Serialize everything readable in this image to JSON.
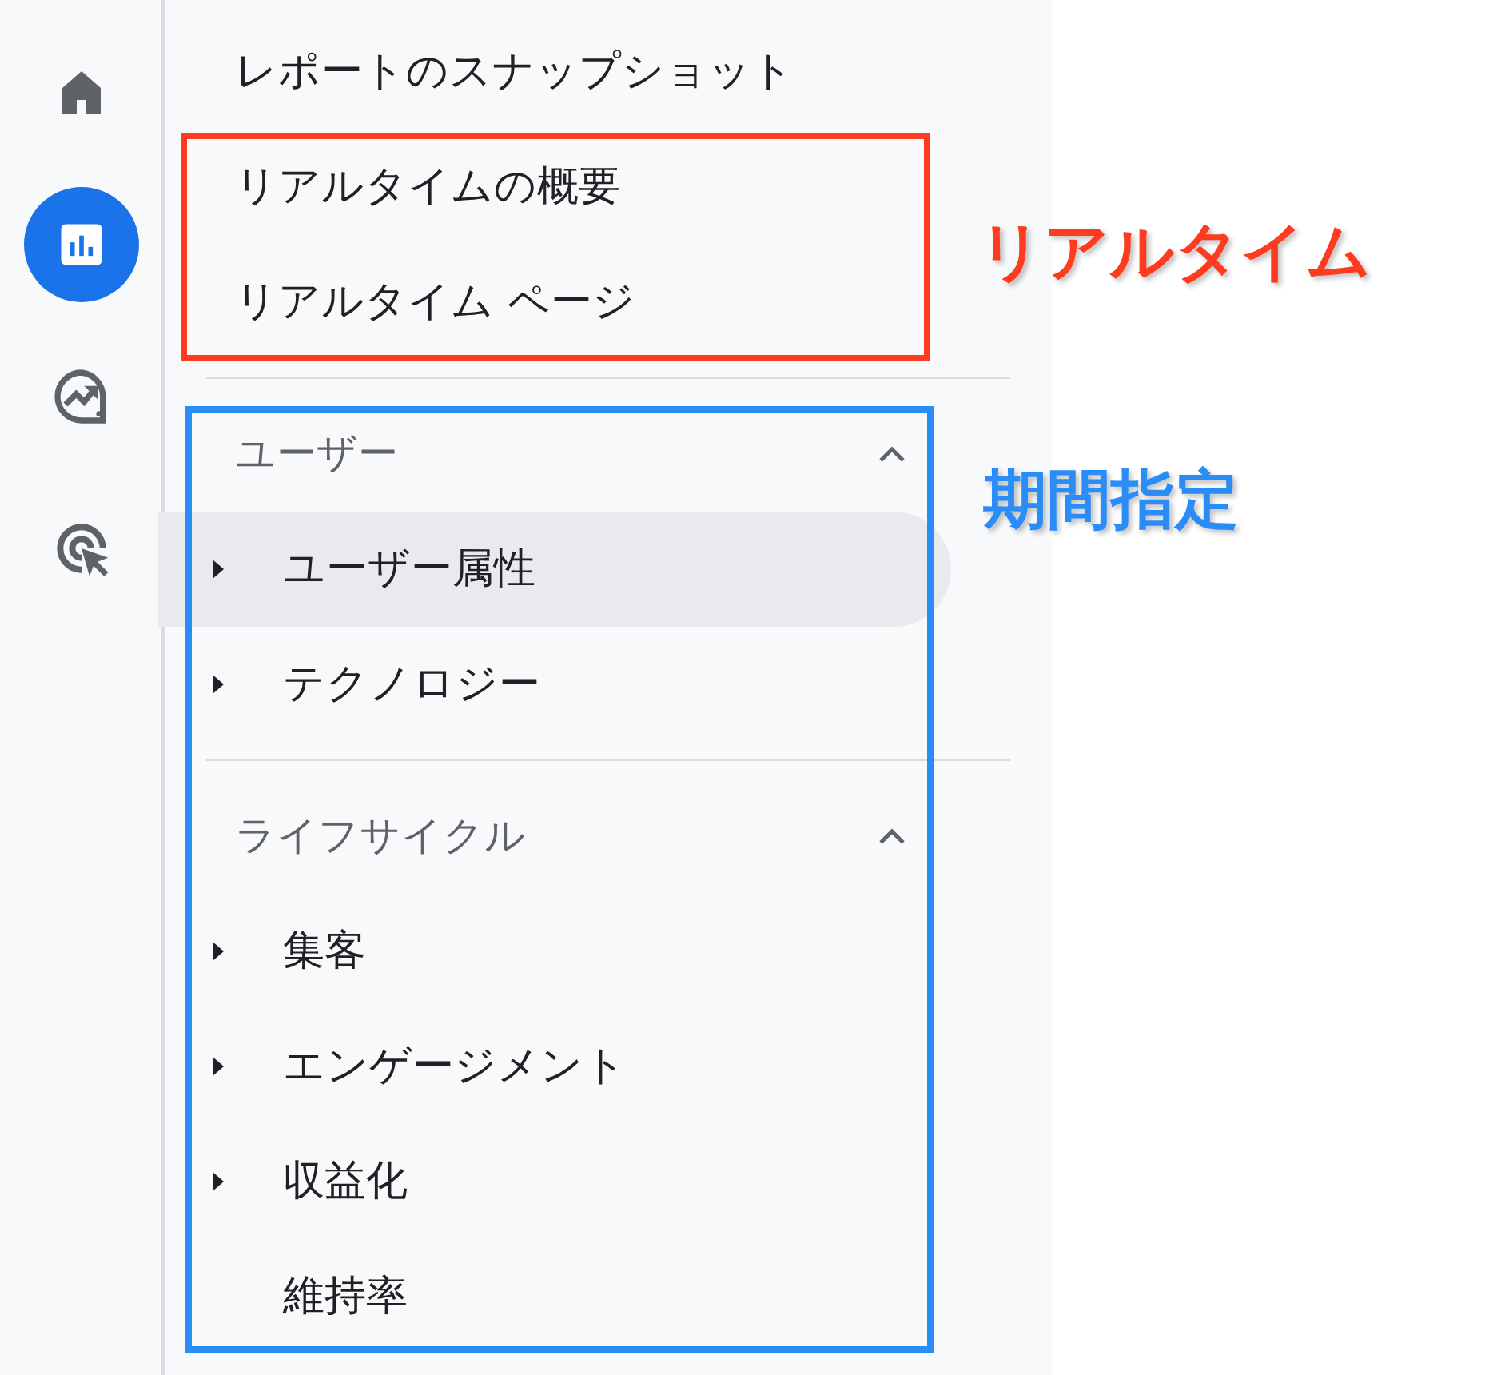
{
  "rail": [
    {
      "selected": false
    },
    {
      "selected": true
    },
    {
      "selected": false
    },
    {
      "selected": false
    }
  ],
  "nav": {
    "top_items": [
      {
        "label": "レポートのスナップショット"
      },
      {
        "label": "リアルタイムの概要"
      },
      {
        "label": "リアルタイム ページ"
      }
    ],
    "sections": [
      {
        "title": "ユーザー",
        "expanded": true,
        "items": [
          {
            "label": "ユーザー属性",
            "has_children": true,
            "highlighted": true
          },
          {
            "label": "テクノロジー",
            "has_children": true,
            "highlighted": false
          }
        ]
      },
      {
        "title": "ライフサイクル",
        "expanded": true,
        "items": [
          {
            "label": "集客",
            "has_children": true,
            "highlighted": false
          },
          {
            "label": "エンゲージメント",
            "has_children": true,
            "highlighted": false
          },
          {
            "label": "収益化",
            "has_children": true,
            "highlighted": false
          },
          {
            "label": "維持率",
            "has_children": false,
            "highlighted": false
          }
        ]
      }
    ]
  },
  "annotations": [
    {
      "kind": "top",
      "text": "リアルタイム",
      "color": "#ff3b1f"
    },
    {
      "kind": "sections",
      "text": "期間指定",
      "color": "#2a8cf6"
    }
  ]
}
